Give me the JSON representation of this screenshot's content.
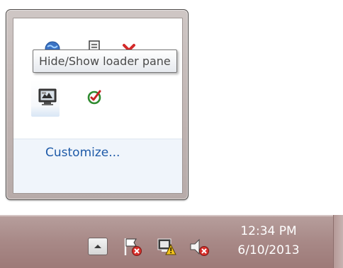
{
  "tooltip": {
    "text": "Hide/Show loader pane"
  },
  "flyout": {
    "customize_label": "Customize..."
  },
  "tray_icons": [
    "globe-network-icon",
    "document-settings-icon",
    "red-x-icon",
    "loader-pane-monitor-icon",
    "green-checkmark-icon"
  ],
  "taskbar": {
    "clock": {
      "time": "12:34 PM",
      "date": "6/10/2013"
    },
    "tray_icons": [
      "show-hidden-icons-up-arrow-icon",
      "action-center-flag-error-icon",
      "network-warning-icon",
      "volume-muted-icon"
    ]
  },
  "colors": {
    "link": "#1e5aa8",
    "taskbar": "#a88987",
    "flyout_frame": "#bfb3b1",
    "footer": "#f0f5fb"
  }
}
